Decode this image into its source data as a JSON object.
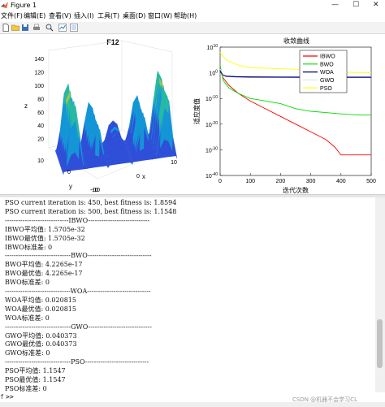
{
  "window": {
    "title": "Figure 1"
  },
  "menu": [
    {
      "label": "文件(F)"
    },
    {
      "label": "编辑(E)"
    },
    {
      "label": "查看(V)"
    },
    {
      "label": "插入(I)"
    },
    {
      "label": "工具(T)"
    },
    {
      "label": "桌面(D)"
    },
    {
      "label": "窗口(W)"
    },
    {
      "label": "帮助(H)"
    }
  ],
  "toolbar_icons": [
    "new-file-icon",
    "open-folder-icon",
    "save-icon",
    "print-icon",
    "zoom-icon",
    "data-cursor-icon",
    "plot-tools-icon"
  ],
  "colors": {
    "IBWO": "#ff0000",
    "BWO": "#00dd00",
    "WOA": "#000080",
    "GWO": "#e6e6e6",
    "PSO": "#ffff00"
  },
  "chart_data": [
    {
      "type": "surface",
      "title": "F12",
      "zlabel": "z",
      "xlabel": "x",
      "ylabel": "y",
      "z_ticks": [
        "140",
        "120",
        "100",
        "80",
        "60",
        "40",
        "20"
      ],
      "x_ticks": [
        "-10",
        "0",
        "10"
      ],
      "y_ticks": [
        "10",
        "0",
        "-10"
      ],
      "zlim": [
        0,
        150
      ]
    },
    {
      "type": "line",
      "title": "收敛曲线",
      "xlabel": "迭代次数",
      "ylabel": "适应度值",
      "yscale": "log",
      "xlim": [
        0,
        500
      ],
      "x_ticks": [
        "0",
        "100",
        "200",
        "300",
        "400",
        "500"
      ],
      "y_ticks": [
        "10^{10}",
        "10^{0}",
        "10^{-10}",
        "10^{-20}",
        "10^{-30}",
        "10^{-40}"
      ],
      "legend_position": "top-right",
      "series": [
        {
          "name": "IBWO",
          "x": [
            0,
            10,
            30,
            60,
            100,
            150,
            200,
            250,
            300,
            350,
            380,
            400,
            450,
            500
          ],
          "y_log10": [
            1,
            -2,
            -5,
            -8,
            -11,
            -14,
            -17,
            -20,
            -23,
            -26,
            -29,
            -32,
            -32,
            -32
          ]
        },
        {
          "name": "BWO",
          "x": [
            0,
            10,
            30,
            60,
            100,
            150,
            200,
            250,
            300,
            350,
            400,
            450,
            500
          ],
          "y_log10": [
            3,
            -3,
            -6,
            -8,
            -10,
            -11,
            -12,
            -14,
            -15,
            -15.5,
            -16,
            -16.4,
            -16.4
          ]
        },
        {
          "name": "WOA",
          "x": [
            0,
            10,
            20,
            50,
            100,
            200,
            300,
            400,
            500
          ],
          "y_log10": [
            1,
            -0.8,
            -1.3,
            -1.5,
            -1.6,
            -1.65,
            -1.68,
            -1.69,
            -1.69
          ]
        },
        {
          "name": "GWO",
          "x": [
            0,
            10,
            20,
            50,
            100,
            200,
            300,
            400,
            500
          ],
          "y_log10": [
            1.5,
            -0.6,
            -1.0,
            -1.2,
            -1.3,
            -1.35,
            -1.38,
            -1.39,
            -1.39
          ]
        },
        {
          "name": "PSO",
          "x": [
            0,
            20,
            60,
            100,
            150,
            200,
            300,
            400,
            500
          ],
          "y_log10": [
            8,
            5,
            3,
            2,
            1.8,
            1.6,
            1.2,
            0.2,
            0.06
          ]
        }
      ]
    }
  ],
  "console": {
    "lines": [
      "PSO current iteration is: 450, best fitness is: 1.8594",
      "PSO current iteration is: 500, best fitness is: 1.1548",
      "-----------------------------IBWO----------------------------",
      "IBWO平均值: 1.5705e-32",
      "IBWO最优值: 1.5705e-32",
      "IBWO标准差: 0",
      "------------------------------BWO-----------------------------",
      "BWO平均值: 4.2265e-17",
      "BWO最优值: 4.2265e-17",
      "BWO标准差: 0",
      "------------------------------WOA-----------------------------",
      "WOA平均值: 0.020815",
      "WOA最优值: 0.020815",
      "WOA标准差: 0",
      "------------------------------GWO-----------------------------",
      "GWO平均值: 0.040373",
      "GWO最优值: 0.040373",
      "GWO标准差: 0",
      "------------------------------PSO-----------------------------",
      "PSO平均值: 1.1547",
      "PSO最优值: 1.1547",
      "PSO标准差: 0"
    ],
    "prompt": ">>"
  },
  "watermark": "CSDN @机器不会学习CL"
}
